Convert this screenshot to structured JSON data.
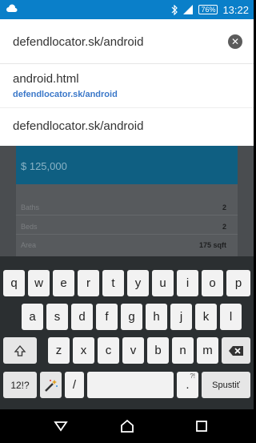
{
  "status": {
    "battery": "76%",
    "time": "13:22"
  },
  "urlbar": {
    "value": "defendlocator.sk/android",
    "clear_label": "✕"
  },
  "suggestions": [
    {
      "title": "android.html",
      "url": "defendlocator.sk/android"
    },
    {
      "title": "defendlocator.sk/android"
    }
  ],
  "page": {
    "price": "$ 125,000",
    "rows": [
      {
        "label": "Baths",
        "value": "2"
      },
      {
        "label": "Beds",
        "value": "2"
      },
      {
        "label": "Area",
        "value": "175 sqft"
      }
    ]
  },
  "keyboard": {
    "row1": [
      "q",
      "w",
      "e",
      "r",
      "t",
      "y",
      "u",
      "i",
      "o",
      "p"
    ],
    "row2": [
      "a",
      "s",
      "d",
      "f",
      "g",
      "h",
      "j",
      "k",
      "l"
    ],
    "row3": [
      "z",
      "x",
      "c",
      "v",
      "b",
      "n",
      "m"
    ],
    "symbols_label": "12!?",
    "slash": "/",
    "period": ".",
    "period_hint": "?!",
    "enter_label": "Spustiť"
  },
  "colors": {
    "statusbar": "#0a7fc9",
    "link": "#3b78c9",
    "keyboard_bg": "#2b2f31"
  }
}
